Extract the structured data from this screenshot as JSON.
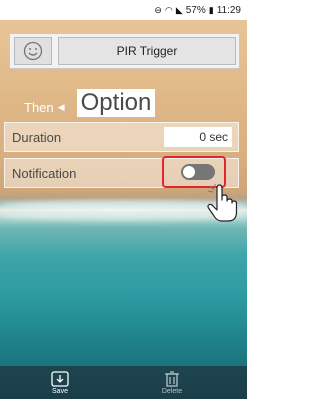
{
  "status": {
    "percent": "57%",
    "time": "11:29"
  },
  "header": {
    "trigger_label": "PIR Trigger"
  },
  "then_label": "Then",
  "option_label": "Option",
  "rows": [
    {
      "label": "Duration",
      "value": "0 sec"
    },
    {
      "label": "Notification",
      "toggle_on": false
    }
  ],
  "bottom": {
    "save_label": "Save",
    "delete_label": "Delete"
  },
  "colors": {
    "highlight": "#e0262f"
  }
}
